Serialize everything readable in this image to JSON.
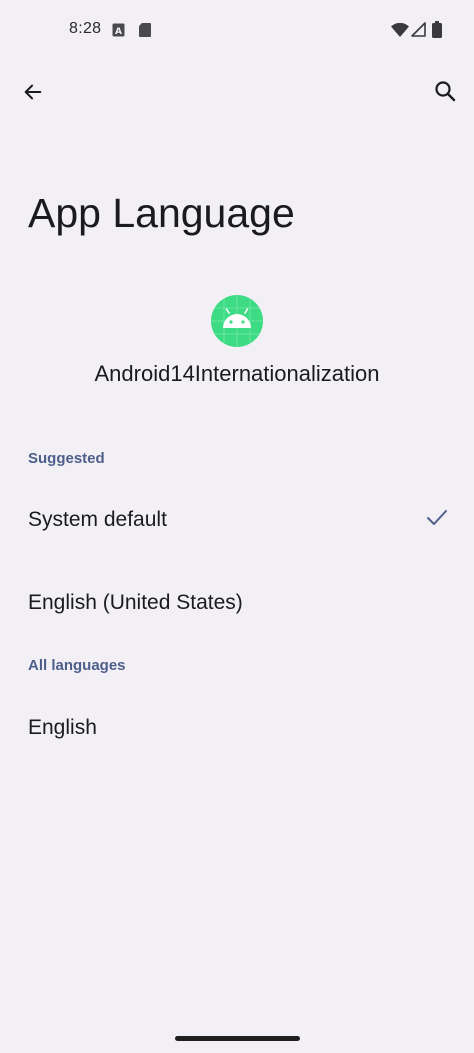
{
  "status_bar": {
    "time": "8:28"
  },
  "toolbar": {
    "back_icon": "arrow-left-icon",
    "search_icon": "search-icon"
  },
  "page": {
    "title": "App Language"
  },
  "app": {
    "name": "Android14Internationalization",
    "icon": "android-robot-icon",
    "icon_color": "#3ddc84"
  },
  "sections": {
    "suggested": {
      "header": "Suggested",
      "items": [
        {
          "label": "System default",
          "selected": true
        },
        {
          "label": "English (United States)",
          "selected": false
        }
      ]
    },
    "all_languages": {
      "header": "All languages",
      "items": [
        {
          "label": "English",
          "selected": false
        }
      ]
    }
  },
  "colors": {
    "background": "#f2f0f4",
    "section_header": "#4e5f8c",
    "check": "#4e5f8c"
  }
}
